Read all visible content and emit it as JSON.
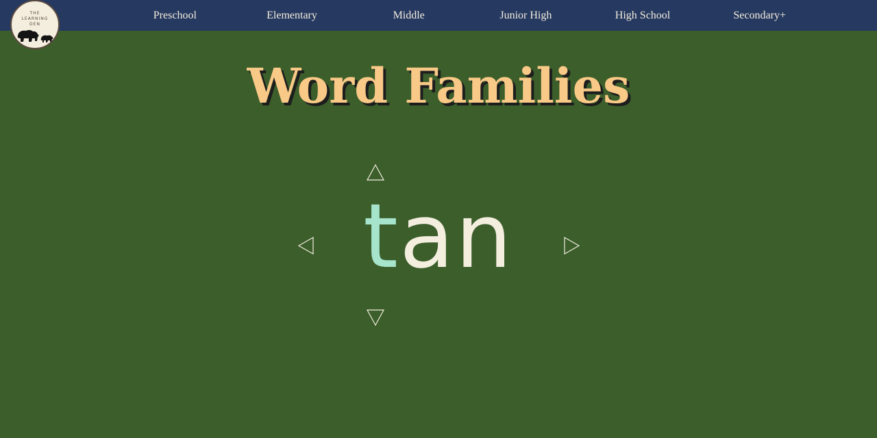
{
  "nav": {
    "logo_lines": [
      "THE",
      "LEARNING",
      "DEN"
    ],
    "items": [
      {
        "label": "Preschool"
      },
      {
        "label": "Elementary"
      },
      {
        "label": "Middle"
      },
      {
        "label": "Junior High"
      },
      {
        "label": "High School"
      },
      {
        "label": "Secondary+"
      }
    ]
  },
  "page": {
    "title": "Word Families"
  },
  "word_card": {
    "onset": "t",
    "rime": "an",
    "onset_color": "#a6e4cc",
    "rime_color": "#f4eedf"
  },
  "controls": {
    "up_icon": "triangle-up-outline-icon",
    "down_icon": "triangle-down-outline-icon",
    "left_icon": "triangle-left-outline-icon",
    "right_icon": "triangle-right-outline-icon"
  },
  "colors": {
    "background": "#3b5e2b",
    "navbar": "#263960",
    "title": "#f9c987",
    "arrow": "#f4eedf"
  }
}
